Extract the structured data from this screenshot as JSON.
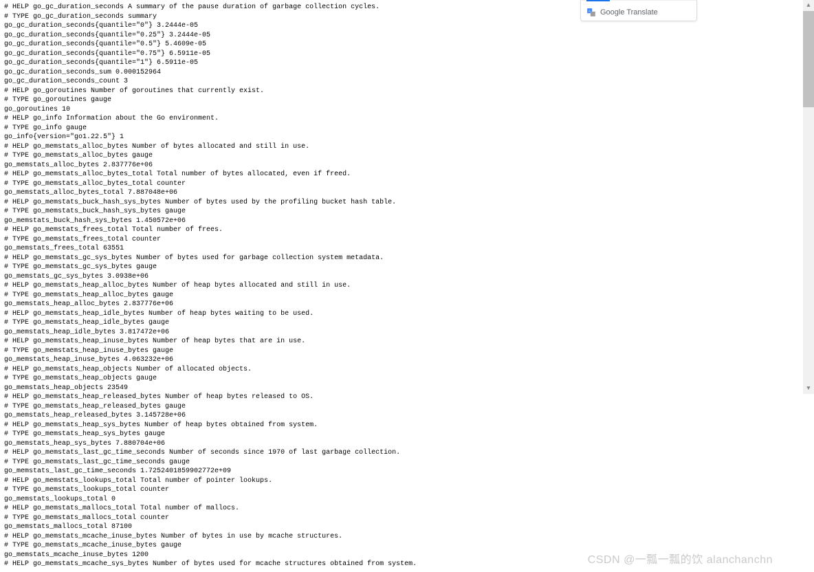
{
  "metrics_lines": [
    "# HELP go_gc_duration_seconds A summary of the pause duration of garbage collection cycles.",
    "# TYPE go_gc_duration_seconds summary",
    "go_gc_duration_seconds{quantile=\"0\"} 3.2444e-05",
    "go_gc_duration_seconds{quantile=\"0.25\"} 3.2444e-05",
    "go_gc_duration_seconds{quantile=\"0.5\"} 5.4609e-05",
    "go_gc_duration_seconds{quantile=\"0.75\"} 6.5911e-05",
    "go_gc_duration_seconds{quantile=\"1\"} 6.5911e-05",
    "go_gc_duration_seconds_sum 0.000152964",
    "go_gc_duration_seconds_count 3",
    "# HELP go_goroutines Number of goroutines that currently exist.",
    "# TYPE go_goroutines gauge",
    "go_goroutines 10",
    "# HELP go_info Information about the Go environment.",
    "# TYPE go_info gauge",
    "go_info{version=\"go1.22.5\"} 1",
    "# HELP go_memstats_alloc_bytes Number of bytes allocated and still in use.",
    "# TYPE go_memstats_alloc_bytes gauge",
    "go_memstats_alloc_bytes 2.837776e+06",
    "# HELP go_memstats_alloc_bytes_total Total number of bytes allocated, even if freed.",
    "# TYPE go_memstats_alloc_bytes_total counter",
    "go_memstats_alloc_bytes_total 7.887048e+06",
    "# HELP go_memstats_buck_hash_sys_bytes Number of bytes used by the profiling bucket hash table.",
    "# TYPE go_memstats_buck_hash_sys_bytes gauge",
    "go_memstats_buck_hash_sys_bytes 1.450572e+06",
    "# HELP go_memstats_frees_total Total number of frees.",
    "# TYPE go_memstats_frees_total counter",
    "go_memstats_frees_total 63551",
    "# HELP go_memstats_gc_sys_bytes Number of bytes used for garbage collection system metadata.",
    "# TYPE go_memstats_gc_sys_bytes gauge",
    "go_memstats_gc_sys_bytes 3.0938e+06",
    "# HELP go_memstats_heap_alloc_bytes Number of heap bytes allocated and still in use.",
    "# TYPE go_memstats_heap_alloc_bytes gauge",
    "go_memstats_heap_alloc_bytes 2.837776e+06",
    "# HELP go_memstats_heap_idle_bytes Number of heap bytes waiting to be used.",
    "# TYPE go_memstats_heap_idle_bytes gauge",
    "go_memstats_heap_idle_bytes 3.817472e+06",
    "# HELP go_memstats_heap_inuse_bytes Number of heap bytes that are in use.",
    "# TYPE go_memstats_heap_inuse_bytes gauge",
    "go_memstats_heap_inuse_bytes 4.063232e+06",
    "# HELP go_memstats_heap_objects Number of allocated objects.",
    "# TYPE go_memstats_heap_objects gauge",
    "go_memstats_heap_objects 23549",
    "# HELP go_memstats_heap_released_bytes Number of heap bytes released to OS.",
    "# TYPE go_memstats_heap_released_bytes gauge",
    "go_memstats_heap_released_bytes 3.145728e+06",
    "# HELP go_memstats_heap_sys_bytes Number of heap bytes obtained from system.",
    "# TYPE go_memstats_heap_sys_bytes gauge",
    "go_memstats_heap_sys_bytes 7.880704e+06",
    "# HELP go_memstats_last_gc_time_seconds Number of seconds since 1970 of last garbage collection.",
    "# TYPE go_memstats_last_gc_time_seconds gauge",
    "go_memstats_last_gc_time_seconds 1.7252401859902772e+09",
    "# HELP go_memstats_lookups_total Total number of pointer lookups.",
    "# TYPE go_memstats_lookups_total counter",
    "go_memstats_lookups_total 0",
    "# HELP go_memstats_mallocs_total Total number of mallocs.",
    "# TYPE go_memstats_mallocs_total counter",
    "go_memstats_mallocs_total 87100",
    "# HELP go_memstats_mcache_inuse_bytes Number of bytes in use by mcache structures.",
    "# TYPE go_memstats_mcache_inuse_bytes gauge",
    "go_memstats_mcache_inuse_bytes 1200",
    "# HELP go_memstats_mcache_sys_bytes Number of bytes used for mcache structures obtained from system."
  ],
  "translate": {
    "label": "Google Translate"
  },
  "watermark": "CSDN @一瓢一瓢的饮 alanchanchn"
}
